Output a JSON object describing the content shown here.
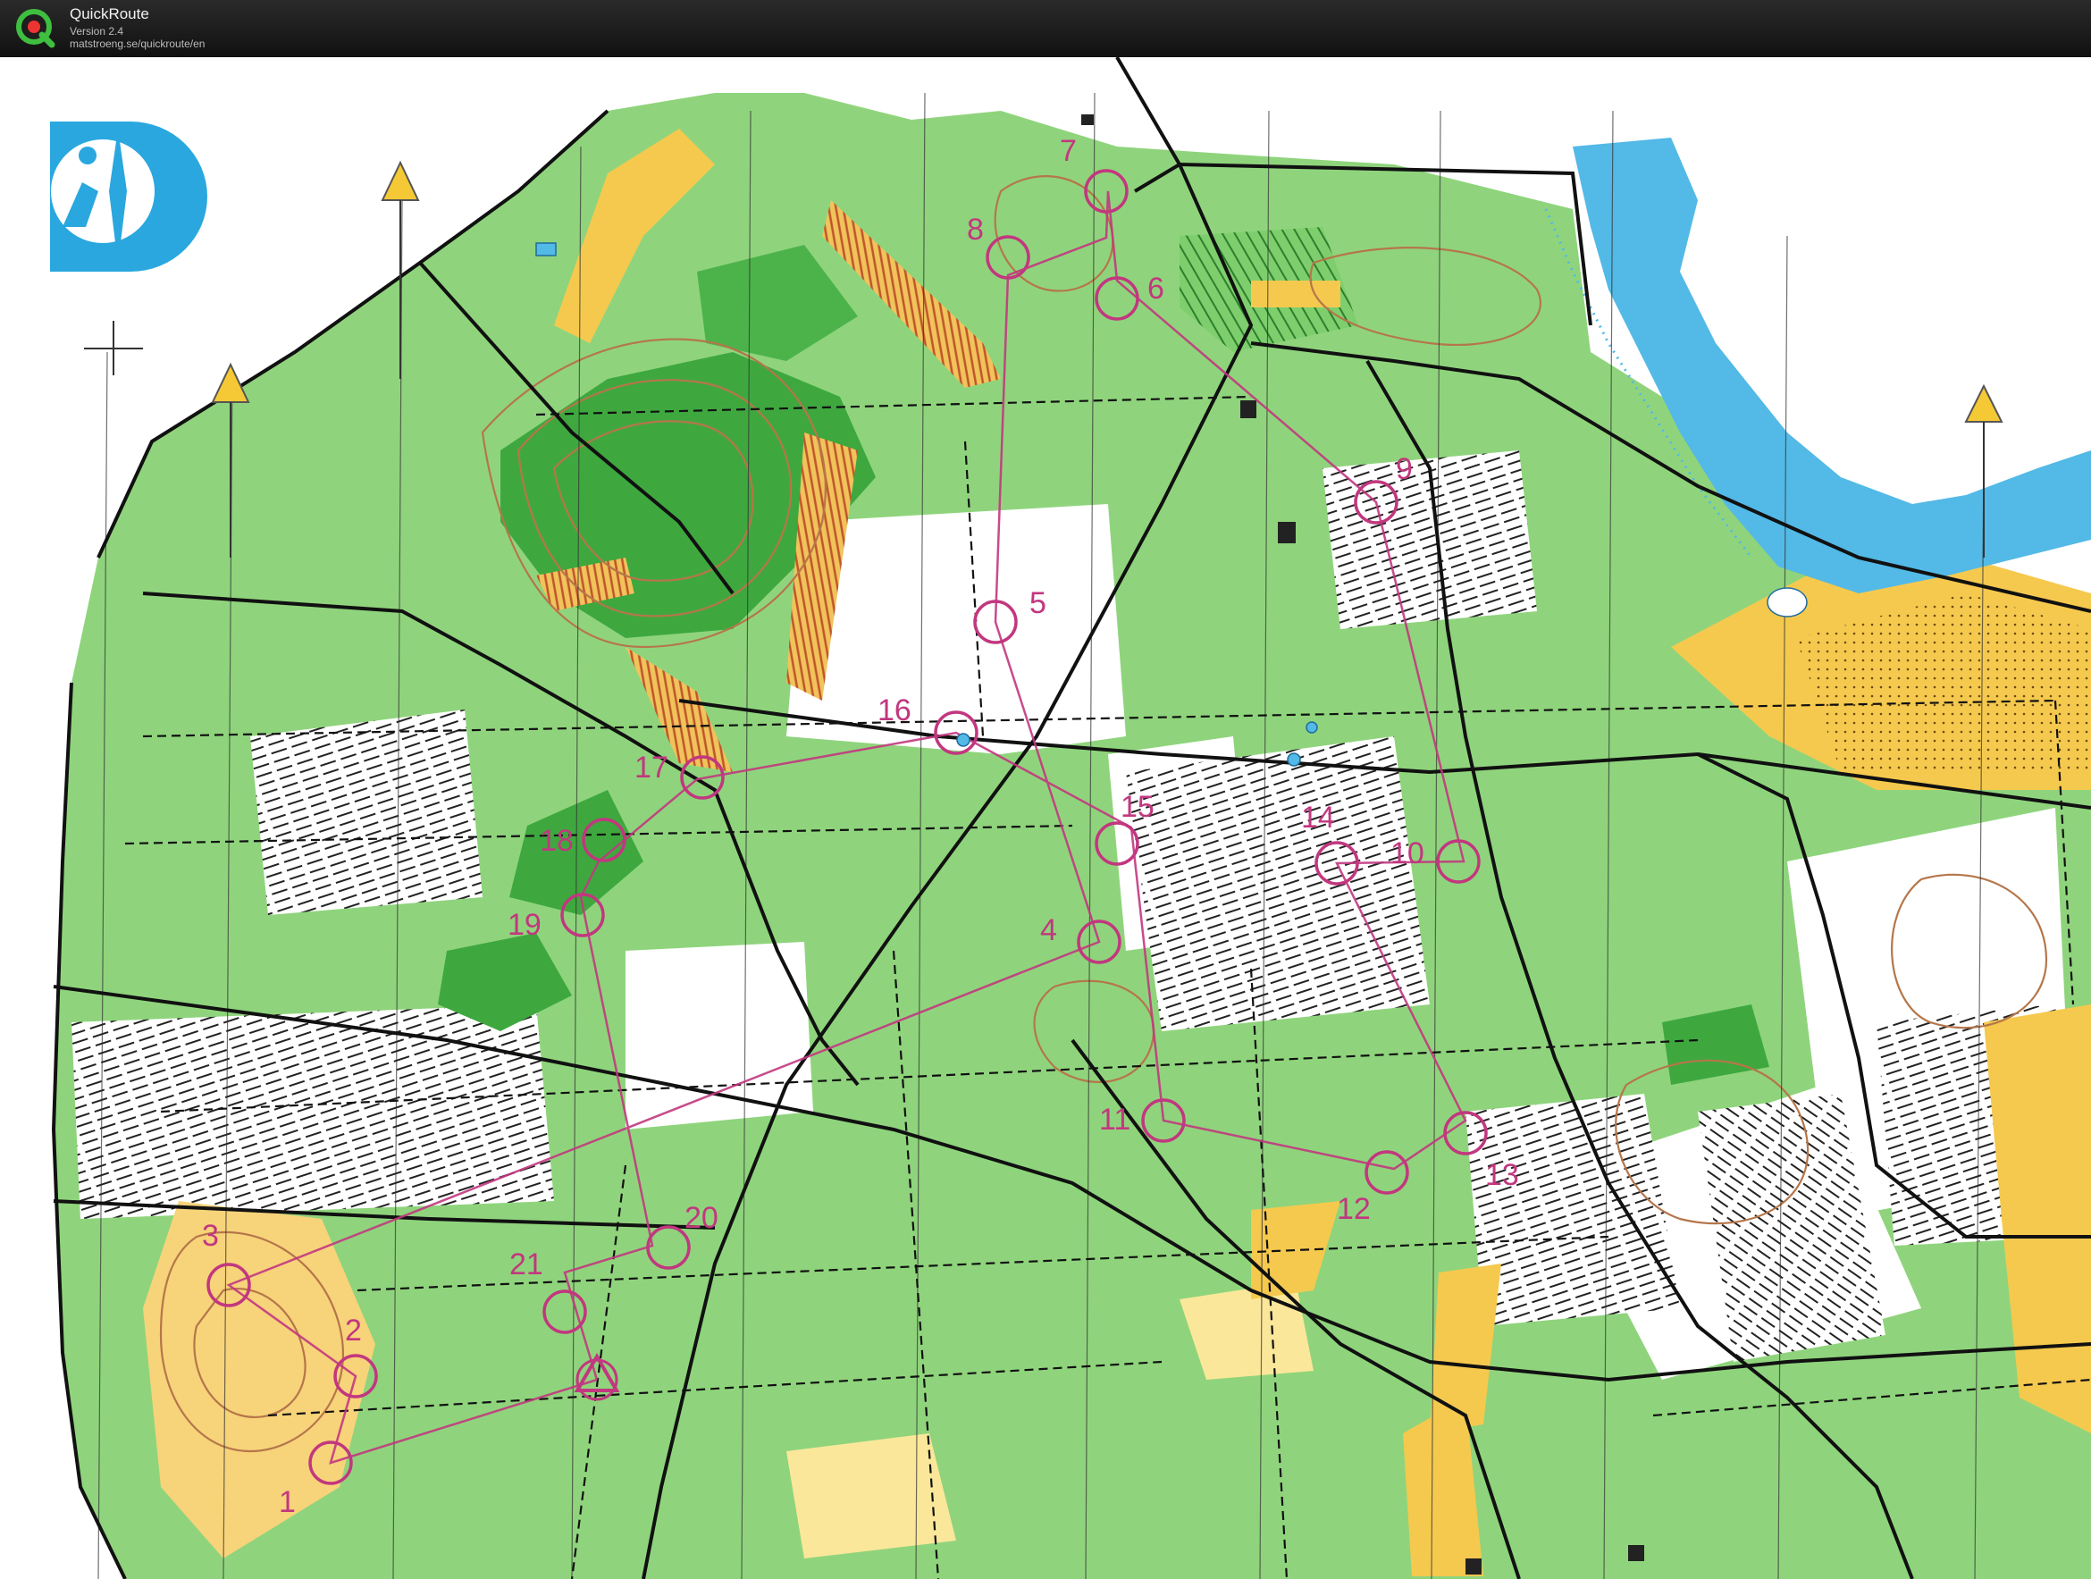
{
  "app": {
    "name": "QuickRoute",
    "version": "Version 2.4",
    "url": "matstroeng.se/quickroute/en"
  },
  "map": {
    "colors": {
      "forest": "#7fce6d",
      "dark_green": "#3ea83f",
      "open_yellow": "#f5c94e",
      "light_yellow": "#fbe79a",
      "water": "#53b9e6",
      "contour": "#b5764a",
      "course": "#c2377f",
      "road": "#111111",
      "paper": "#ffffff",
      "logo_blue": "#2aa7df"
    },
    "icons": [
      "orienteering-logo-icon",
      "north-arrow-icon",
      "start-triangle-icon",
      "control-circle-icon"
    ],
    "controls": [
      {
        "label": "1"
      },
      {
        "label": "2"
      },
      {
        "label": "3"
      },
      {
        "label": "4"
      },
      {
        "label": "5"
      },
      {
        "label": "6"
      },
      {
        "label": "7"
      },
      {
        "label": "8"
      },
      {
        "label": "9"
      },
      {
        "label": "10"
      },
      {
        "label": "11"
      },
      {
        "label": "12"
      },
      {
        "label": "13"
      },
      {
        "label": "14"
      },
      {
        "label": "15"
      },
      {
        "label": "16"
      },
      {
        "label": "17"
      },
      {
        "label": "18"
      },
      {
        "label": "19"
      },
      {
        "label": "20"
      },
      {
        "label": "21"
      }
    ]
  }
}
